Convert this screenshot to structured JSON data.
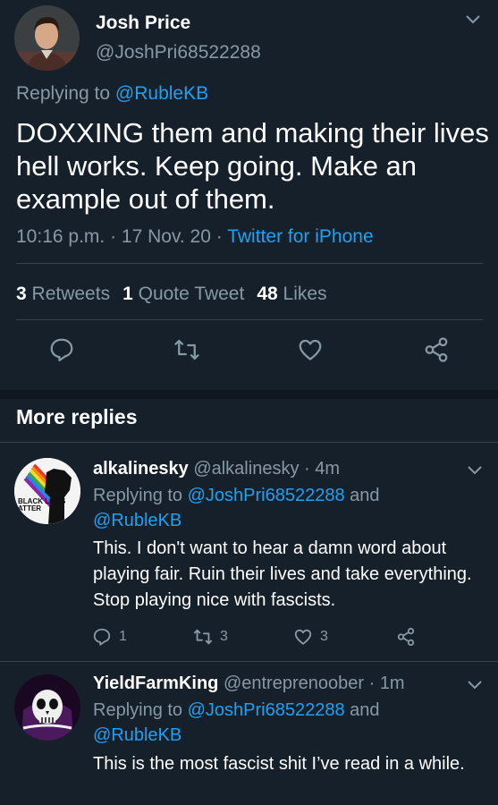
{
  "main_tweet": {
    "name": "Josh Price",
    "handle": "@JoshPri68522288",
    "replying_prefix": "Replying to ",
    "replying_to": "@RubleKB",
    "text": "DOXXING them and making their lives hell works. Keep going. Make an example out of them.",
    "time": "10:16 p.m.",
    "date": "17 Nov. 20",
    "source": "Twitter for iPhone",
    "sep": " · ",
    "stats": {
      "retweets_count": "3",
      "retweets_label": "Retweets",
      "quotes_count": "1",
      "quotes_label": "Quote Tweet",
      "likes_count": "48",
      "likes_label": "Likes"
    },
    "icons": [
      "reply-icon",
      "retweet-icon",
      "like-icon",
      "share-icon"
    ]
  },
  "more_replies": {
    "title": "More replies",
    "replies": [
      {
        "name": "alkalinesky",
        "handle": "@alkalinesky",
        "time": "4m",
        "replying_prefix": "Replying to ",
        "replying_to_1": "@JoshPri68522288",
        "and": " and ",
        "replying_to_2": "@RubleKB",
        "text": "This. I don't want to hear a damn word about playing fair. Ruin their lives and take everything. Stop playing nice with fascists.",
        "reply_count": "1",
        "retweet_count": "3",
        "like_count": "3",
        "avatar_text": "BLACK LIVES ATTER"
      },
      {
        "name": "YieldFarmKing",
        "handle": "@entreprenoober",
        "time": "1m",
        "replying_prefix": "Replying to ",
        "replying_to_1": "@JoshPri68522288",
        "and": " and ",
        "replying_to_2": "@RubleKB",
        "text": "This is the most fascist shit I’ve read in a while."
      }
    ]
  },
  "colors": {
    "background": "#15202b",
    "text": "#ffffff",
    "secondary": "#8899a6",
    "accent": "#1da1f2",
    "divider": "#38444d"
  }
}
